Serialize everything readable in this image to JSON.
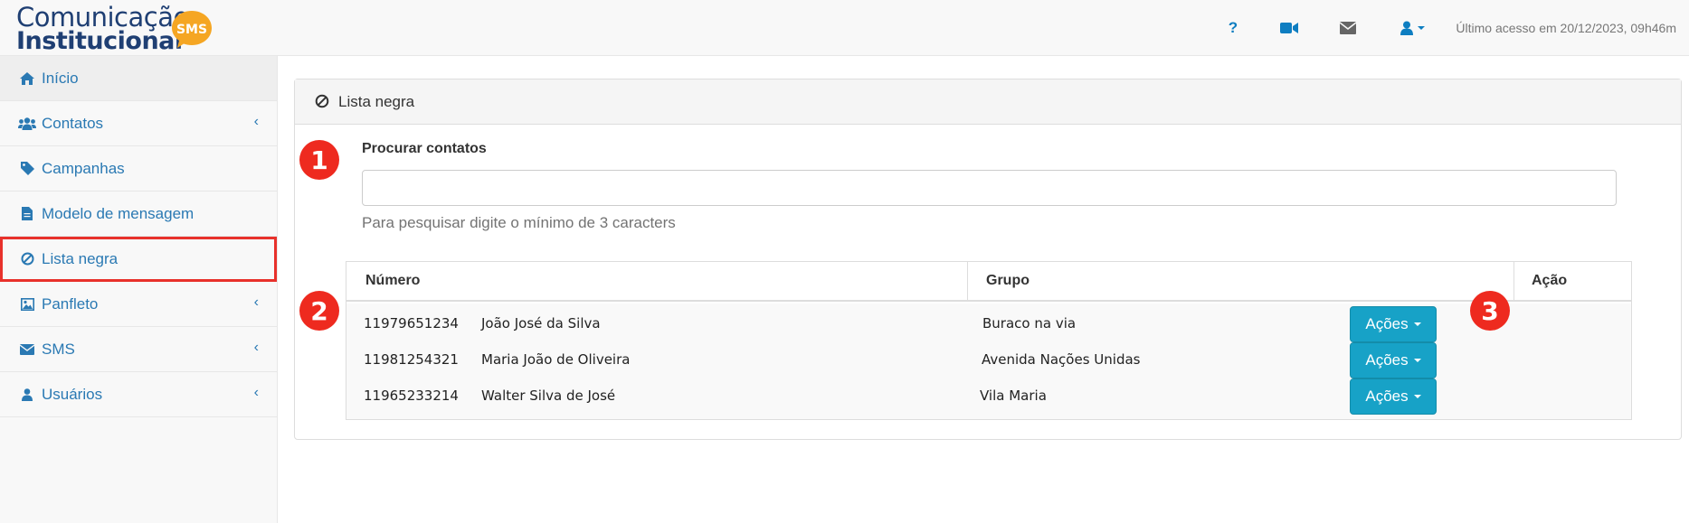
{
  "header": {
    "logo_line1": "Comunicação",
    "logo_line2": "Institucional",
    "logo_badge": "SMS",
    "help_label": "?",
    "last_access": "Último acesso em 20/12/2023, 09h46m"
  },
  "sidebar": {
    "items": [
      {
        "label": "Início",
        "icon": "home-icon"
      },
      {
        "label": "Contatos",
        "icon": "users-icon",
        "has_submenu": true
      },
      {
        "label": "Campanhas",
        "icon": "tag-icon"
      },
      {
        "label": "Modelo de mensagem",
        "icon": "file-icon"
      },
      {
        "label": "Lista negra",
        "icon": "ban-icon"
      },
      {
        "label": "Panfleto",
        "icon": "image-icon",
        "has_submenu": true
      },
      {
        "label": "SMS",
        "icon": "envelope-icon",
        "has_submenu": true
      },
      {
        "label": "Usuários",
        "icon": "user-icon",
        "has_submenu": true
      }
    ]
  },
  "panel": {
    "title": "Lista negra",
    "search": {
      "label": "Procurar contatos",
      "value": "",
      "placeholder": "",
      "help": "Para pesquisar digite o mínimo de 3 caracters"
    },
    "table": {
      "headers": [
        "Número",
        "Grupo",
        "Ação"
      ],
      "rows": [
        {
          "numero": "11979651234",
          "nome": "João José da Silva",
          "grupo": "Buraco na via",
          "acao": "Ações"
        },
        {
          "numero": "11981254321",
          "nome": "Maria João de Oliveira",
          "grupo": "Avenida Nações Unidas",
          "acao": "Ações"
        },
        {
          "numero": "11965233214",
          "nome": "Walter Silva de José",
          "grupo": "Vila Maria",
          "acao": "Ações"
        }
      ]
    }
  },
  "annotations": [
    "1",
    "2",
    "3"
  ],
  "colors": {
    "link": "#2a79b3",
    "accent_button": "#17a2c7",
    "badge_red": "#ee2a1f",
    "logo_navy": "#1f3f73",
    "logo_orange": "#f5a623"
  }
}
